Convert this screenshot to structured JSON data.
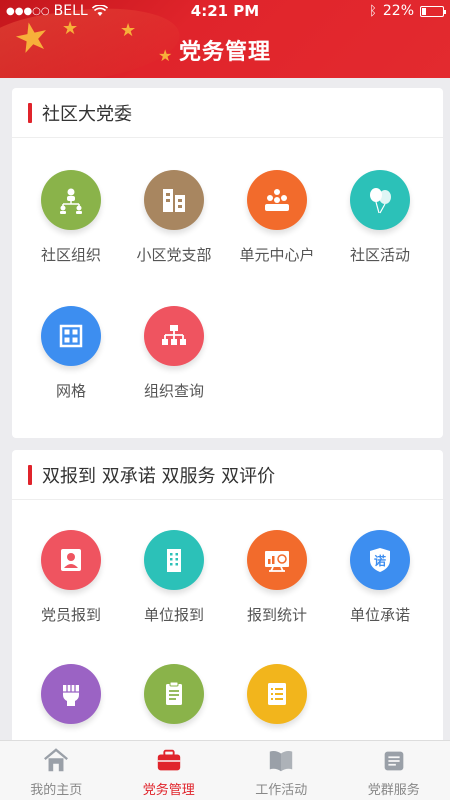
{
  "status_bar": {
    "carrier": "BELL",
    "time": "4:21 PM",
    "battery": "22%",
    "battery_level": 0.22
  },
  "header": {
    "title": "党务管理"
  },
  "section1": {
    "title": "社区大党委",
    "items": [
      {
        "label": "社区组织",
        "icon": "org-chart-icon",
        "color": "#8ab34a"
      },
      {
        "label": "小区党支部",
        "icon": "buildings-icon",
        "color": "#a88660"
      },
      {
        "label": "单元中心户",
        "icon": "party-members-icon",
        "color": "#f26b2c"
      },
      {
        "label": "社区活动",
        "icon": "balloons-icon",
        "color": "#2cc1b8"
      },
      {
        "label": "网格",
        "icon": "grid-icon",
        "color": "#3d8ef0"
      },
      {
        "label": "组织查询",
        "icon": "hierarchy-icon",
        "color": "#ef5460"
      }
    ]
  },
  "section2": {
    "title": "双报到 双承诺 双服务 双评价",
    "items": [
      {
        "label": "党员报到",
        "icon": "person-icon",
        "color": "#ef5460"
      },
      {
        "label": "单位报到",
        "icon": "building-icon",
        "color": "#2cc1b8"
      },
      {
        "label": "报到统计",
        "icon": "statistics-icon",
        "color": "#f26b2c"
      },
      {
        "label": "单位承诺",
        "icon": "promise-shield-icon",
        "color": "#3d8ef0",
        "glyph": "诺"
      },
      {
        "label": "",
        "icon": "fist-icon",
        "color": "#9b63c4"
      },
      {
        "label": "",
        "icon": "clipboard-icon",
        "color": "#8ab34a"
      },
      {
        "label": "",
        "icon": "list-icon",
        "color": "#f2b51c"
      }
    ]
  },
  "tabbar": {
    "tabs": [
      {
        "label": "我的主页",
        "icon": "home-icon"
      },
      {
        "label": "党务管理",
        "icon": "briefcase-icon",
        "active": true
      },
      {
        "label": "工作活动",
        "icon": "book-icon"
      },
      {
        "label": "党群服务",
        "icon": "service-icon"
      }
    ]
  }
}
